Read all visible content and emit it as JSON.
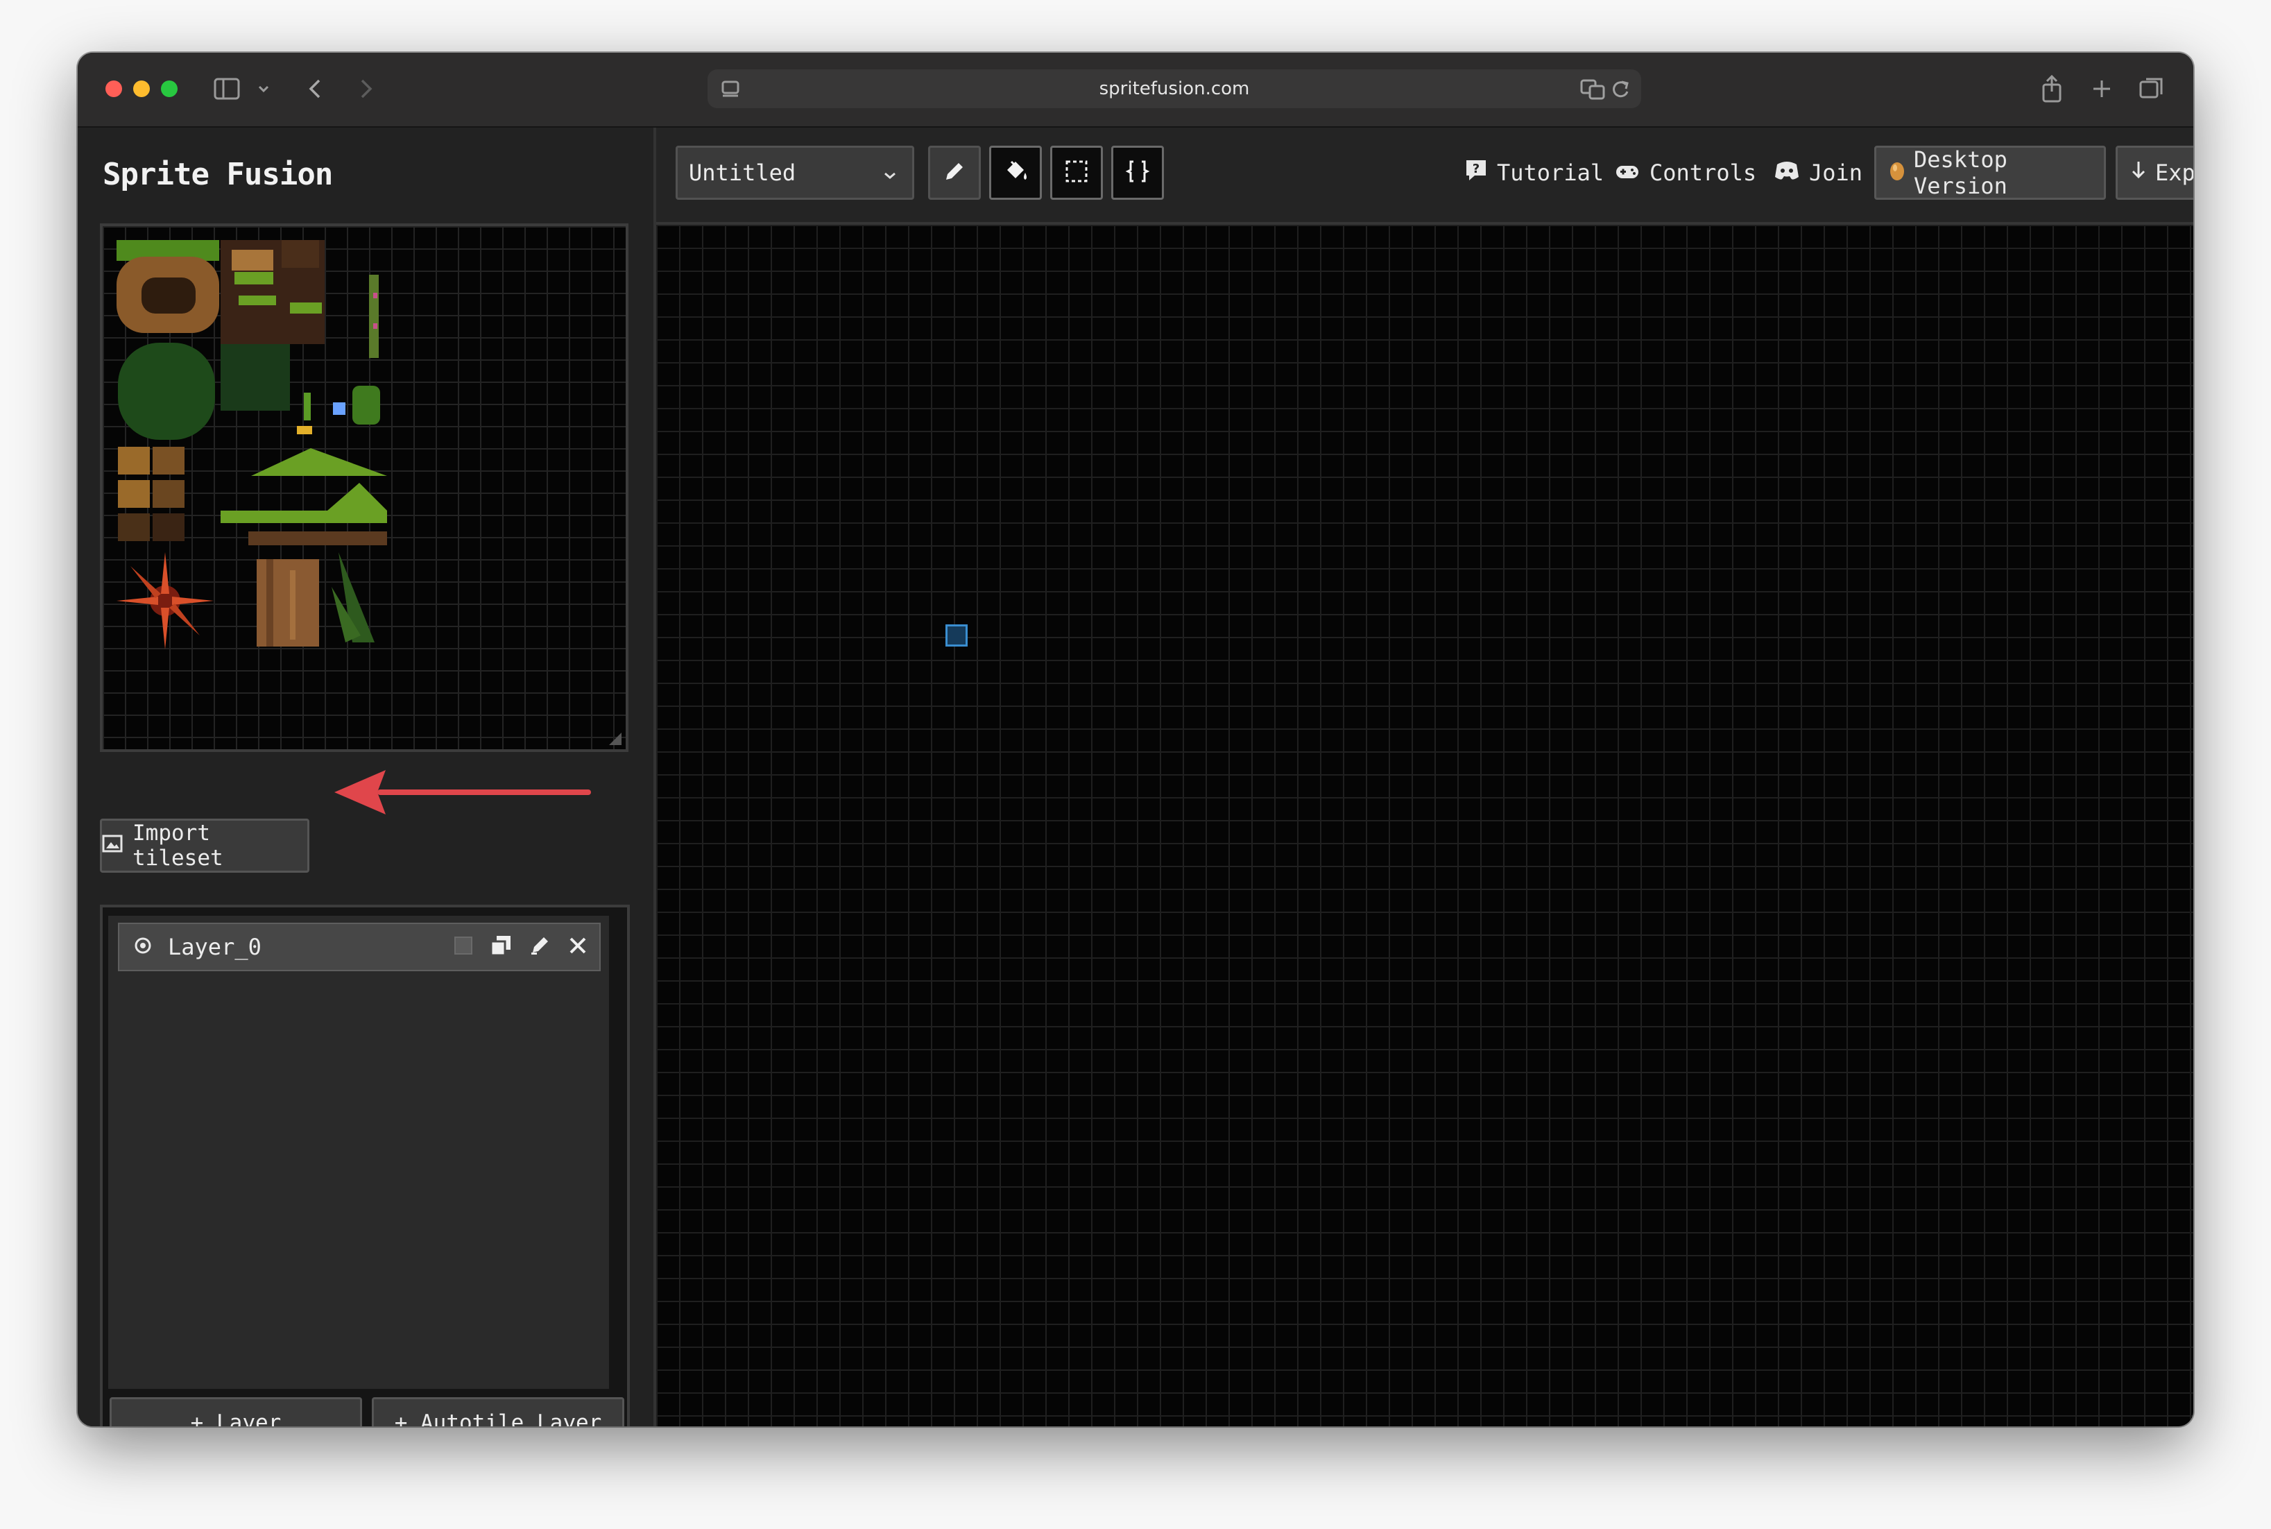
{
  "browser": {
    "url": "spritefusion.com"
  },
  "app": {
    "title": "Sprite Fusion"
  },
  "tileset_panel": {
    "import_button_label": "Import tileset"
  },
  "layers_panel": {
    "layers": [
      {
        "name": "Layer_0"
      }
    ],
    "add_layer_label": "+ Layer",
    "add_autotile_label": "+ Autotile Layer"
  },
  "toolbar": {
    "map_name": "Untitled",
    "tools": [
      "pencil-icon",
      "fill-bucket-icon",
      "selection-icon",
      "braces-icon"
    ],
    "links": {
      "tutorial": "Tutorial",
      "controls": "Controls",
      "join": "Join",
      "desktop_version": "Desktop Version",
      "export": "Export"
    }
  },
  "colors": {
    "annotation_arrow": "#e0464b",
    "canvas_background": "#050505",
    "cursor_tile": "#3a8ed0"
  }
}
